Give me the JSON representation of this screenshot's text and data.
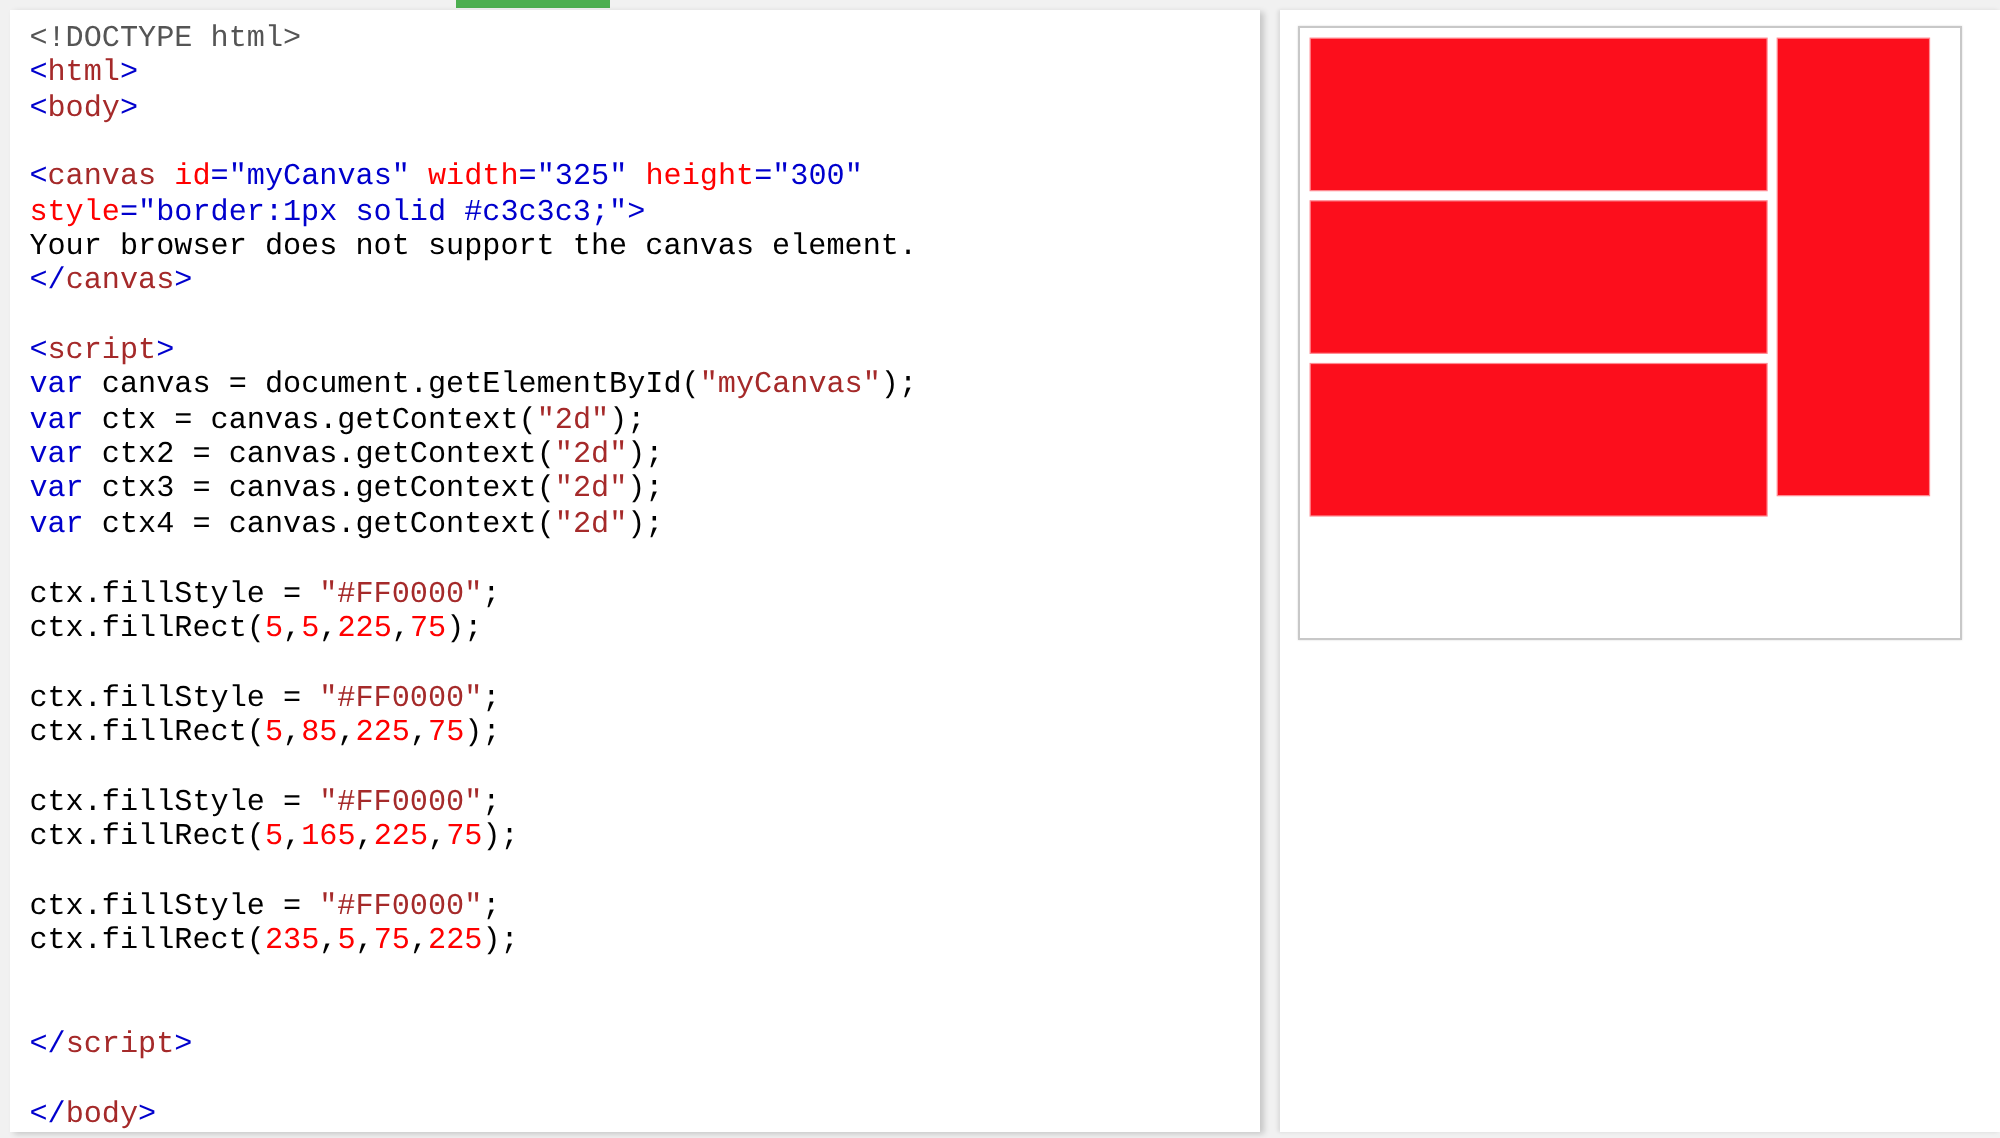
{
  "editor": {
    "lines": [
      {
        "kind": "code",
        "tokens": [
          {
            "kind": "doctype",
            "text": "<!DOCTYPE html>"
          }
        ]
      },
      {
        "kind": "code",
        "tokens": [
          {
            "kind": "punct",
            "text": "<"
          },
          {
            "kind": "tag",
            "text": "html"
          },
          {
            "kind": "punct",
            "text": ">"
          }
        ]
      },
      {
        "kind": "code",
        "tokens": [
          {
            "kind": "punct",
            "text": "<"
          },
          {
            "kind": "tag",
            "text": "body"
          },
          {
            "kind": "punct",
            "text": ">"
          }
        ]
      },
      {
        "kind": "blank"
      },
      {
        "kind": "code",
        "tokens": [
          {
            "kind": "punct",
            "text": "<"
          },
          {
            "kind": "tag",
            "text": "canvas"
          },
          {
            "kind": "attr",
            "text": " id"
          },
          {
            "kind": "value",
            "text": "=\"myCanvas\""
          },
          {
            "kind": "attr",
            "text": " width"
          },
          {
            "kind": "value",
            "text": "=\"325\""
          },
          {
            "kind": "attr",
            "text": " height"
          },
          {
            "kind": "value",
            "text": "=\"300\""
          }
        ]
      },
      {
        "kind": "code",
        "tokens": [
          {
            "kind": "attr",
            "text": "style"
          },
          {
            "kind": "value",
            "text": "=\"border:1px solid #c3c3c3;\""
          },
          {
            "kind": "punct",
            "text": ">"
          }
        ]
      },
      {
        "kind": "code",
        "tokens": [
          {
            "kind": "plain",
            "text": "Your browser does not support the canvas element."
          }
        ]
      },
      {
        "kind": "code",
        "tokens": [
          {
            "kind": "punct",
            "text": "</"
          },
          {
            "kind": "tag",
            "text": "canvas"
          },
          {
            "kind": "punct",
            "text": ">"
          }
        ]
      },
      {
        "kind": "blank"
      },
      {
        "kind": "code",
        "tokens": [
          {
            "kind": "punct",
            "text": "<"
          },
          {
            "kind": "tag",
            "text": "script"
          },
          {
            "kind": "punct",
            "text": ">"
          }
        ]
      },
      {
        "kind": "code",
        "tokens": [
          {
            "kind": "keyword",
            "text": "var"
          },
          {
            "kind": "plain",
            "text": " canvas = document.getElementById("
          },
          {
            "kind": "string",
            "text": "\"myCanvas\""
          },
          {
            "kind": "plain",
            "text": ");"
          }
        ]
      },
      {
        "kind": "code",
        "tokens": [
          {
            "kind": "keyword",
            "text": "var"
          },
          {
            "kind": "plain",
            "text": " ctx = canvas.getContext("
          },
          {
            "kind": "string",
            "text": "\"2d\""
          },
          {
            "kind": "plain",
            "text": ");"
          }
        ]
      },
      {
        "kind": "code",
        "tokens": [
          {
            "kind": "keyword",
            "text": "var"
          },
          {
            "kind": "plain",
            "text": " ctx2 = canvas.getContext("
          },
          {
            "kind": "string",
            "text": "\"2d\""
          },
          {
            "kind": "plain",
            "text": ");"
          }
        ]
      },
      {
        "kind": "code",
        "tokens": [
          {
            "kind": "keyword",
            "text": "var"
          },
          {
            "kind": "plain",
            "text": " ctx3 = canvas.getContext("
          },
          {
            "kind": "string",
            "text": "\"2d\""
          },
          {
            "kind": "plain",
            "text": ");"
          }
        ]
      },
      {
        "kind": "code",
        "tokens": [
          {
            "kind": "keyword",
            "text": "var"
          },
          {
            "kind": "plain",
            "text": " ctx4 = canvas.getContext("
          },
          {
            "kind": "string",
            "text": "\"2d\""
          },
          {
            "kind": "plain",
            "text": ");"
          }
        ]
      },
      {
        "kind": "blank"
      },
      {
        "kind": "code",
        "tokens": [
          {
            "kind": "plain",
            "text": "ctx.fillStyle = "
          },
          {
            "kind": "string",
            "text": "\"#FF0000\""
          },
          {
            "kind": "plain",
            "text": ";"
          }
        ]
      },
      {
        "kind": "code",
        "tokens": [
          {
            "kind": "plain",
            "text": "ctx.fillRect("
          },
          {
            "kind": "number",
            "text": "5"
          },
          {
            "kind": "plain",
            "text": ","
          },
          {
            "kind": "number",
            "text": "5"
          },
          {
            "kind": "plain",
            "text": ","
          },
          {
            "kind": "number",
            "text": "225"
          },
          {
            "kind": "plain",
            "text": ","
          },
          {
            "kind": "number",
            "text": "75"
          },
          {
            "kind": "plain",
            "text": ");"
          }
        ]
      },
      {
        "kind": "blank"
      },
      {
        "kind": "code",
        "tokens": [
          {
            "kind": "plain",
            "text": "ctx.fillStyle = "
          },
          {
            "kind": "string",
            "text": "\"#FF0000\""
          },
          {
            "kind": "plain",
            "text": ";"
          }
        ]
      },
      {
        "kind": "code",
        "tokens": [
          {
            "kind": "plain",
            "text": "ctx.fillRect("
          },
          {
            "kind": "number",
            "text": "5"
          },
          {
            "kind": "plain",
            "text": ","
          },
          {
            "kind": "number",
            "text": "85"
          },
          {
            "kind": "plain",
            "text": ","
          },
          {
            "kind": "number",
            "text": "225"
          },
          {
            "kind": "plain",
            "text": ","
          },
          {
            "kind": "number",
            "text": "75"
          },
          {
            "kind": "plain",
            "text": ");"
          }
        ]
      },
      {
        "kind": "blank"
      },
      {
        "kind": "code",
        "tokens": [
          {
            "kind": "plain",
            "text": "ctx.fillStyle = "
          },
          {
            "kind": "string",
            "text": "\"#FF0000\""
          },
          {
            "kind": "plain",
            "text": ";"
          }
        ]
      },
      {
        "kind": "code",
        "tokens": [
          {
            "kind": "plain",
            "text": "ctx.fillRect("
          },
          {
            "kind": "number",
            "text": "5"
          },
          {
            "kind": "plain",
            "text": ","
          },
          {
            "kind": "number",
            "text": "165"
          },
          {
            "kind": "plain",
            "text": ","
          },
          {
            "kind": "number",
            "text": "225"
          },
          {
            "kind": "plain",
            "text": ","
          },
          {
            "kind": "number",
            "text": "75"
          },
          {
            "kind": "plain",
            "text": ");"
          }
        ]
      },
      {
        "kind": "blank"
      },
      {
        "kind": "code",
        "tokens": [
          {
            "kind": "plain",
            "text": "ctx.fillStyle = "
          },
          {
            "kind": "string",
            "text": "\"#FF0000\""
          },
          {
            "kind": "plain",
            "text": ";"
          }
        ]
      },
      {
        "kind": "code",
        "tokens": [
          {
            "kind": "plain",
            "text": "ctx.fillRect("
          },
          {
            "kind": "number",
            "text": "235"
          },
          {
            "kind": "plain",
            "text": ","
          },
          {
            "kind": "number",
            "text": "5"
          },
          {
            "kind": "plain",
            "text": ","
          },
          {
            "kind": "number",
            "text": "75"
          },
          {
            "kind": "plain",
            "text": ","
          },
          {
            "kind": "number",
            "text": "225"
          },
          {
            "kind": "plain",
            "text": ");"
          }
        ]
      },
      {
        "kind": "blank"
      },
      {
        "kind": "blank"
      },
      {
        "kind": "code",
        "tokens": [
          {
            "kind": "punct",
            "text": "</"
          },
          {
            "kind": "tag",
            "text": "script"
          },
          {
            "kind": "punct",
            "text": ">"
          }
        ]
      },
      {
        "kind": "blank"
      },
      {
        "kind": "code",
        "tokens": [
          {
            "kind": "punct",
            "text": "</"
          },
          {
            "kind": "tag",
            "text": "body"
          },
          {
            "kind": "punct",
            "text": ">"
          }
        ]
      }
    ]
  },
  "preview": {
    "shapes": [
      {
        "kind": "rectangle"
      },
      {
        "kind": "rectangle"
      },
      {
        "kind": "rectangle"
      },
      {
        "kind": "rectangle"
      }
    ]
  }
}
